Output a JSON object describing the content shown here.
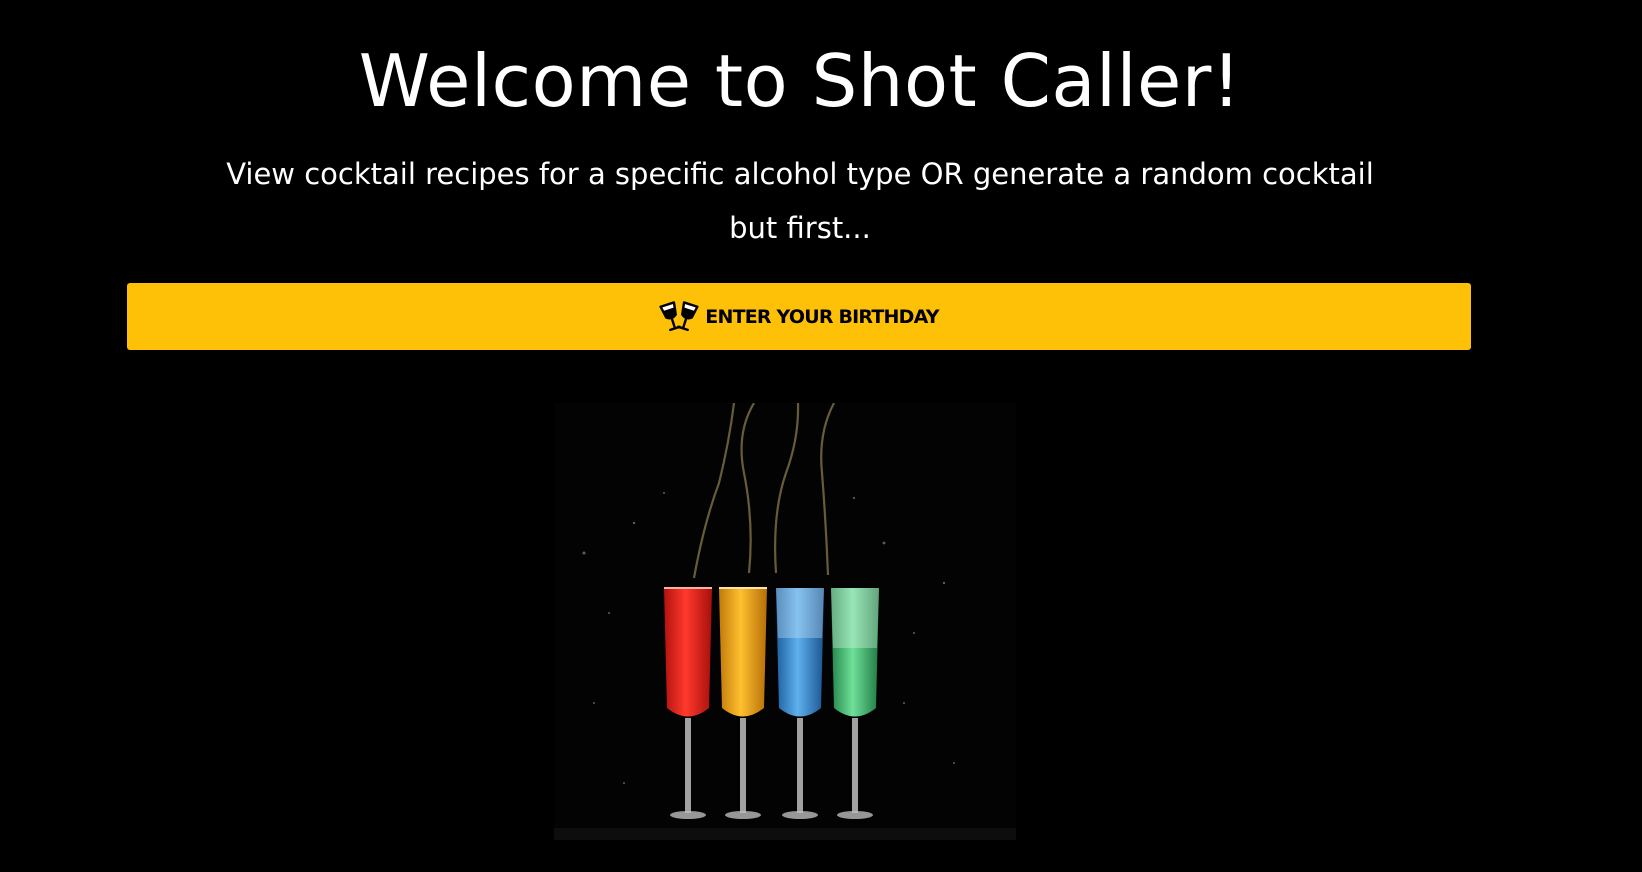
{
  "header": {
    "title": "Welcome to Shot Caller!",
    "subtitle_line1": "View cocktail recipes for a specific alcohol type OR generate a random cocktail",
    "subtitle_line2": "but first..."
  },
  "cta": {
    "label": "ENTER YOUR BIRTHDAY",
    "icon": "clinking-glasses-icon",
    "background_color": "#FFC107"
  },
  "hero_image": {
    "subject": "four-champagne-flutes-cocktails",
    "colors": [
      "#E8231E",
      "#F2A51A",
      "#3A8FD6",
      "#3FBF6A"
    ]
  }
}
